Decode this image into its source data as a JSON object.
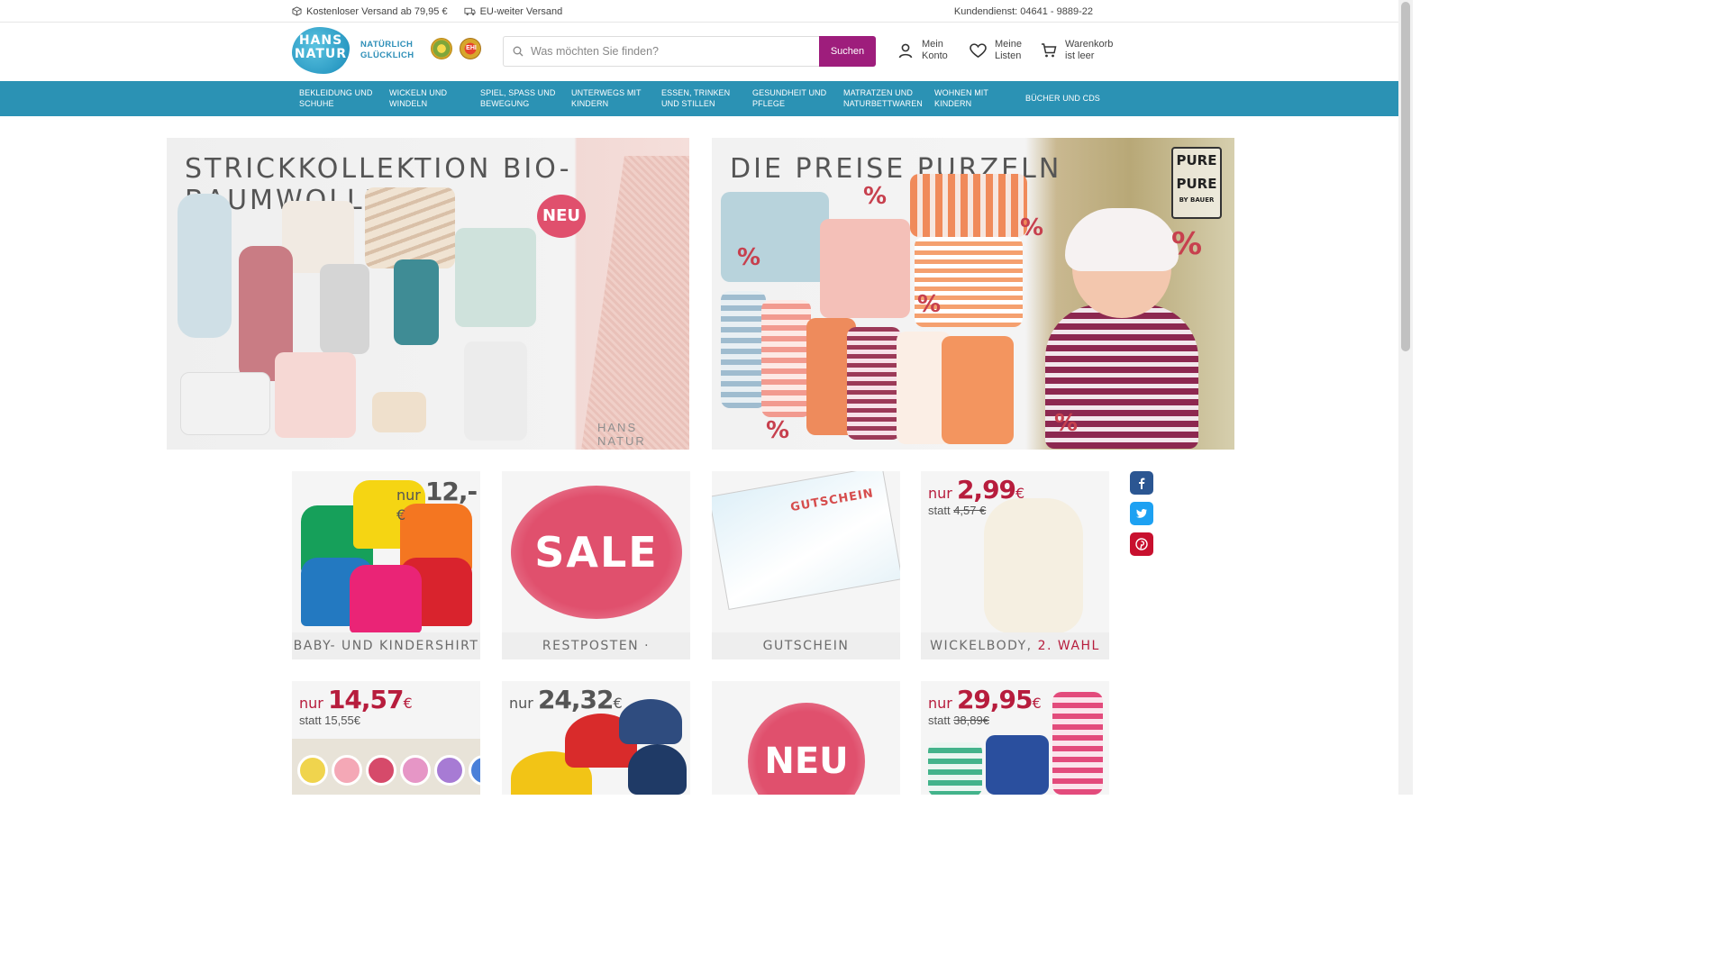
{
  "topbar": {
    "shipping_free": "Kostenloser Versand ab 79,95 €",
    "shipping_eu": "EU-weiter Versand",
    "service": "Kundendienst: 04641 - 9889-22"
  },
  "header": {
    "logo_text": "HANS NATUR",
    "slogan_line1": "NATÜRLICH",
    "slogan_line2": "GLÜCKLICH",
    "search_placeholder": "Was möchten Sie finden?",
    "search_button": "Suchen",
    "account_line1": "Mein",
    "account_line2": "Konto",
    "lists_line1": "Meine",
    "lists_line2": "Listen",
    "cart_line1": "Warenkorb",
    "cart_line2": "ist leer",
    "seal2_text": "EHI"
  },
  "nav": [
    "Bekleidung und Schuhe",
    "Wickeln und Windeln",
    "Spiel, Spass und Bewegung",
    "Unterwegs mit Kindern",
    "Essen, Trinken und Stillen",
    "Gesundheit und Pflege",
    "Matratzen und Naturbettwaren",
    "Wohnen mit Kindern",
    "Bücher und CDs"
  ],
  "banners": {
    "left_title": "Strickkollektion Bio-Baumwolle",
    "left_badge": "NEU",
    "left_watermark": "HANS NATUR",
    "right_title": "Die Preise purzeln",
    "right_brand": "PURE PURE",
    "right_brand_sub": "BY BAUER",
    "percent": "%"
  },
  "tiles": {
    "t1": {
      "nur": "nur",
      "price": "12,-",
      "cur": "€",
      "caption": "Baby- und Kindershirt"
    },
    "t2": {
      "oval": "SALE",
      "caption": "Restposten · Schnäppchen"
    },
    "t3": {
      "voucher": "GUTSCHEIN",
      "caption": "Gutschein"
    },
    "t4": {
      "nur": "nur",
      "price": "2,99",
      "cur": "€",
      "statt": "statt",
      "old": "4,57 €",
      "caption_a": "Wickelbody,",
      "caption_b": "2. Wahl"
    },
    "t5": {
      "nur": "nur",
      "price": "14,57",
      "cur": "€",
      "statt": "statt 15,55€"
    },
    "t6": {
      "nur": "nur",
      "price": "24,32",
      "cur": "€"
    },
    "t7": {
      "oval": "NEU"
    },
    "t8": {
      "nur": "nur",
      "price": "29,95",
      "cur": "€",
      "statt": "statt",
      "old": "38,89€"
    }
  },
  "colors": {
    "nav_bg": "#2b92b4",
    "accent": "#9e1d7c",
    "price_red": "#b71d3d",
    "sale_pink": "#e0506d"
  },
  "icons": [
    "box-icon",
    "truck-icon",
    "search-icon",
    "user-icon",
    "heart-icon",
    "cart-icon",
    "facebook-icon",
    "twitter-icon",
    "pinterest-icon"
  ]
}
